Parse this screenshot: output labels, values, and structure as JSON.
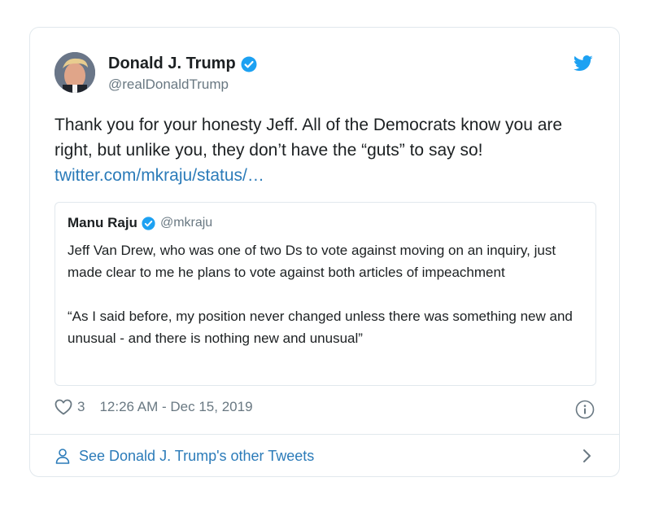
{
  "author": {
    "name": "Donald J. Trump",
    "handle": "@realDonaldTrump",
    "avatar": "avatar",
    "verified_icon": "verified-badge-icon"
  },
  "tweet": {
    "text": "Thank you for your honesty Jeff. All of the Democrats know you are right, but unlike you, they don’t have the “guts” to say so!",
    "link": "twitter.com/mkraju/status/…"
  },
  "quoted": {
    "name": "Manu Raju",
    "handle": "@mkraju",
    "paragraph1": "Jeff Van Drew, who was one of two Ds to vote against moving on an inquiry, just made clear to me he plans to vote against both articles of impeachment",
    "paragraph2": "“As I said before, my position never changed unless there was something new and unusual - and there is nothing new and unusual”"
  },
  "meta": {
    "likes": "3",
    "timestamp": "12:26 AM - Dec 15, 2019"
  },
  "footer": {
    "label": "See Donald J. Trump's other Tweets"
  },
  "colors": {
    "link": "#2b7bb9",
    "verified": "#1da1f2",
    "secondary_text": "#697882",
    "border": "#e1e8ed"
  }
}
